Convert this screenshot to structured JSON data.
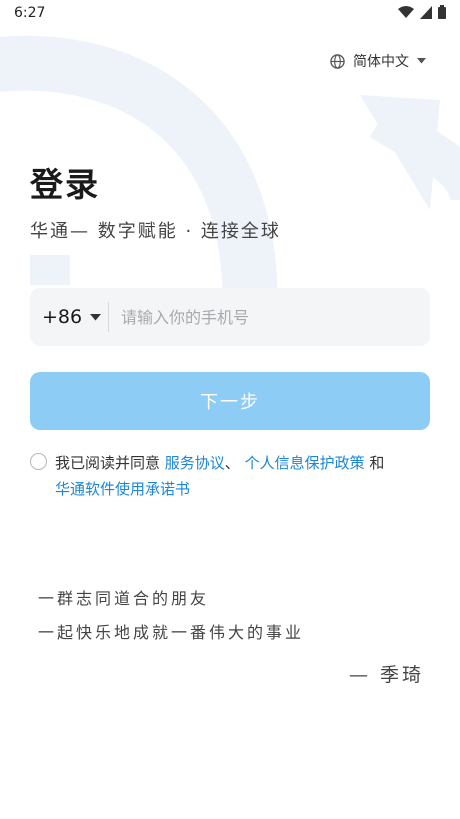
{
  "status_bar": {
    "time": "6:27"
  },
  "language": {
    "label": "简体中文"
  },
  "login": {
    "title": "登录",
    "subtitle": "华通— 数字赋能 · 连接全球"
  },
  "phone": {
    "country_code": "+86",
    "placeholder": "请输入你的手机号",
    "value": ""
  },
  "next_button": {
    "label": "下一步"
  },
  "agreement": {
    "prefix": "我已阅读并同意 ",
    "link_service": "服务协议",
    "sep": "、 ",
    "link_privacy": "个人信息保护政策",
    "and": " 和",
    "link_software": "华通软件使用承诺书"
  },
  "quote": {
    "line1": "一群志同道合的朋友",
    "line2": "一起快乐地成就一番伟大的事业",
    "author": "— 季琦"
  },
  "colors": {
    "accent_link": "#1c86d8",
    "button_disabled": "#8dccf5",
    "input_bg": "#f4f5f7"
  },
  "icons": [
    "wifi-icon",
    "signal-icon",
    "battery-icon",
    "globe-icon",
    "caret-down-icon",
    "radio-unchecked-icon"
  ]
}
